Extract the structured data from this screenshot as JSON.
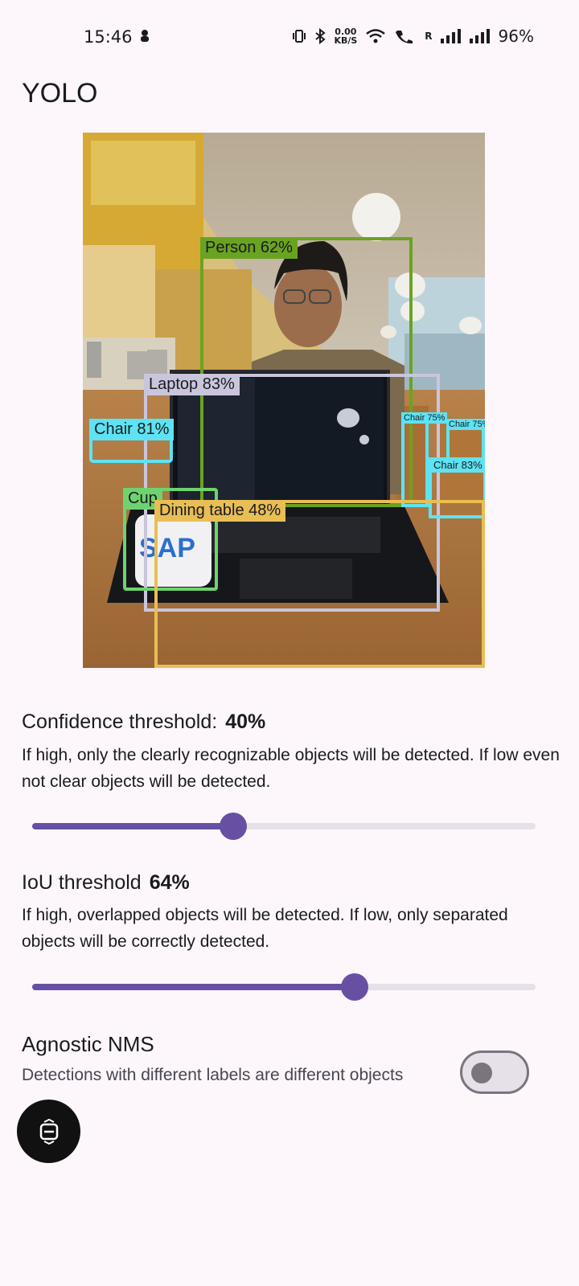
{
  "status": {
    "time": "15:46",
    "net_speed_value": "0.00",
    "net_speed_unit": "KB/S",
    "roaming": "R",
    "battery": "96%"
  },
  "app": {
    "title": "YOLO"
  },
  "detections": [
    {
      "label": "Person 62%",
      "color": "#6aa321"
    },
    {
      "label": "Laptop 83%",
      "color": "#c9c6dc"
    },
    {
      "label": "Chair 81%",
      "color": "#5de3f3"
    },
    {
      "label": "Chair 75%",
      "color": "#5de3f3"
    },
    {
      "label": "Chair 83%",
      "color": "#5de3f3"
    },
    {
      "label": "Chair 75%",
      "color": "#5de3f3"
    },
    {
      "label": "Cup",
      "color": "#6ed36e"
    },
    {
      "label": "Dining table 48%",
      "color": "#e8be55"
    }
  ],
  "confidence": {
    "title": "Confidence threshold:",
    "value": "40%",
    "level": 0.4,
    "description": "If high, only the clearly recognizable objects will be detected. If low even not clear objects will be detected."
  },
  "iou": {
    "title": "IoU threshold",
    "value": "64%",
    "level": 0.64,
    "description": "If high, overlapped objects will be detected. If low, only separated objects will be correctly detected."
  },
  "nms": {
    "title": "Agnostic NMS",
    "description": "Detections with different labels are different objects",
    "enabled": false
  },
  "colors": {
    "accent": "#6750a4",
    "background": "#fdf7fc"
  },
  "icons": {
    "fab": "camera-switch-icon"
  }
}
